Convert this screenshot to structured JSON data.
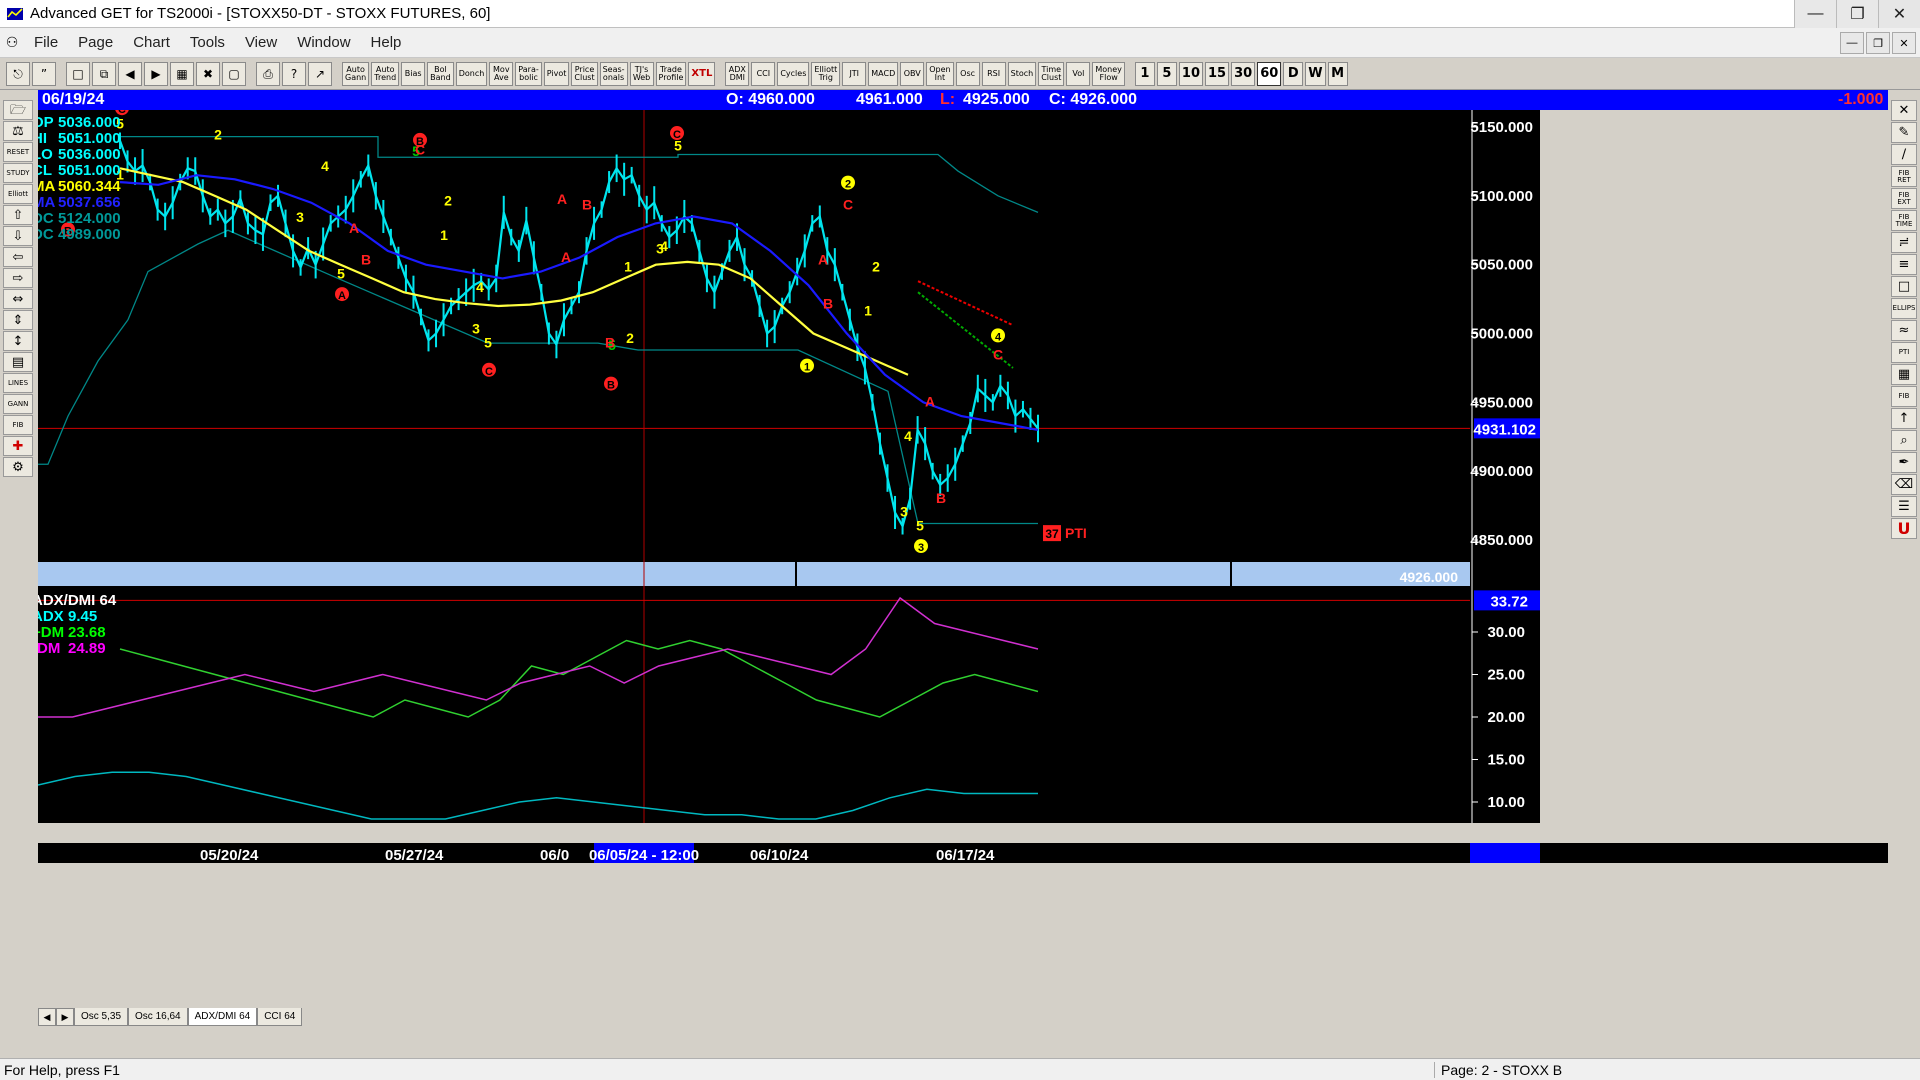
{
  "window": {
    "title": "Advanced GET for TS2000i - [STOXX50-DT - STOXX FUTURES, 60]"
  },
  "menu": [
    "File",
    "Page",
    "Chart",
    "Tools",
    "View",
    "Window",
    "Help"
  ],
  "toolbar": {
    "study_buttons": [
      "Auto\nGann",
      "Auto\nTrend",
      "Bias",
      "Bol\nBand",
      "Donch",
      "Mov\nAve",
      "Para-\nbolic",
      "Pivot",
      "Price\nClust",
      "Seas-\nonals",
      "TJ's\nWeb",
      "Trade\nProfile",
      "XTL"
    ],
    "study_buttons_2": [
      "ADX\nDMI",
      "CCI",
      "Cycles",
      "Elliott\nTrig",
      "JTI",
      "MACD",
      "OBV",
      "Open\nInt",
      "Osc",
      "RSI",
      "Stoch",
      "Time\nClust",
      "Vol",
      "Money\nFlow"
    ],
    "intervals": [
      "1",
      "5",
      "10",
      "15",
      "30",
      "60",
      "D",
      "W",
      "M"
    ],
    "active_interval": "60"
  },
  "left_tools": [
    "RESET",
    "STUDY",
    "Elliott",
    "LINES",
    "GANN",
    "FIB"
  ],
  "right_tools": [
    "FIB RET",
    "FIB EXT",
    "FIB TIME",
    "ELLIPS",
    "PTI",
    "FIB"
  ],
  "info_bar": {
    "date": "06/19/24",
    "open": "O: 4960.000",
    "high": "4961.000",
    "low_label": "L:",
    "low": "4925.000",
    "close": "C: 4926.000",
    "change": "-1.000"
  },
  "price_panel": {
    "stats": [
      {
        "label": "OP",
        "value": "5036.000",
        "color": "#00ffff"
      },
      {
        "label": "HI",
        "value": "5051.000",
        "color": "#00ffff"
      },
      {
        "label": "LO",
        "value": "5036.000",
        "color": "#00ffff"
      },
      {
        "label": "CL",
        "value": "5051.000",
        "color": "#00ffff"
      },
      {
        "label": "MA",
        "value": "5060.344",
        "color": "#ffff00"
      },
      {
        "label": "MA",
        "value": "5037.656",
        "color": "#2222ff"
      },
      {
        "label": "DC",
        "value": "5124.000",
        "color": "#009999"
      },
      {
        "label": "DC",
        "value": "4989.000",
        "color": "#009999"
      }
    ],
    "y_ticks": [
      "5150.000",
      "5100.000",
      "5050.000",
      "5000.000",
      "4950.000",
      "4900.000",
      "4850.000"
    ],
    "y_tick_values": [
      5150,
      5100,
      5050,
      5000,
      4950,
      4900,
      4850
    ],
    "last_price": "4931.102",
    "last_price_value": 4931.102,
    "band_label": "4926.000",
    "pti_value": "37",
    "pti_label": "PTI"
  },
  "adx_panel": {
    "title": "ADX/DMI 64",
    "stats": [
      {
        "label": "ADX",
        "value": "9.45",
        "color": "#00ffff"
      },
      {
        "label": "+DM",
        "value": "23.68",
        "color": "#00ff00"
      },
      {
        "label": "-DM",
        "value": "24.89",
        "color": "#ff00ff"
      }
    ],
    "y_ticks": [
      "30.00",
      "25.00",
      "20.00",
      "15.00",
      "10.00"
    ],
    "y_tick_values": [
      30,
      25,
      20,
      15,
      10
    ],
    "level_label": "33.72",
    "level_value": 33.72
  },
  "x_axis": {
    "ticks": [
      "05/20/24",
      "05/27/24",
      "06/0",
      "06/10/24",
      "06/17/24"
    ],
    "cursor_label": "06/05/24 - 12:00"
  },
  "sheet_tabs": [
    "Osc 5,35",
    "Osc 16,64",
    "ADX/DMI 64",
    "CCI 64"
  ],
  "active_tab": "ADX/DMI 64",
  "status": {
    "help": "For Help, press F1",
    "page": "Page: 2 - STOXX B"
  },
  "chart_data": {
    "type": "line",
    "instrument": "STOXX50-DT - STOXX FUTURES, 60",
    "price_series": [
      5140,
      5125,
      5118,
      5122,
      5110,
      5090,
      5085,
      5095,
      5110,
      5120,
      5118,
      5100,
      5085,
      5090,
      5080,
      5085,
      5098,
      5080,
      5075,
      5072,
      5095,
      5100,
      5080,
      5060,
      5048,
      5062,
      5050,
      5065,
      5080,
      5085,
      5090,
      5100,
      5112,
      5122,
      5100,
      5085,
      5070,
      5055,
      5040,
      5030,
      5012,
      4995,
      5000,
      5010,
      5020,
      5025,
      5030,
      5035,
      5038,
      5032,
      5040,
      5088,
      5070,
      5060,
      5082,
      5055,
      5030,
      5000,
      4992,
      5010,
      5020,
      5030,
      5060,
      5080,
      5090,
      5110,
      5120,
      5112,
      5115,
      5100,
      5090,
      5095,
      5080,
      5070,
      5075,
      5085,
      5080,
      5060,
      5040,
      5030,
      5045,
      5060,
      5070,
      5050,
      5040,
      5020,
      5000,
      5005,
      5020,
      5030,
      5045,
      5060,
      5080,
      5085,
      5060,
      5050,
      5030,
      5010,
      4990,
      4975,
      4950,
      4920,
      4895,
      4870,
      4860,
      4880,
      4930,
      4920,
      4900,
      4890,
      4895,
      4905,
      4920,
      4935,
      4960,
      4955,
      4950,
      4962,
      4955,
      4940,
      4945,
      4938,
      4931
    ],
    "ma_slow": [
      5120,
      5115,
      5110,
      5100,
      5090,
      5075,
      5060,
      5050,
      5040,
      5030,
      5025,
      5022,
      5020,
      5021,
      5024,
      5030,
      5040,
      5050,
      5052,
      5050,
      5040,
      5020,
      5000,
      4990,
      4980,
      4970
    ],
    "ma_fast": [
      5110,
      5108,
      5115,
      5112,
      5105,
      5095,
      5080,
      5060,
      5050,
      5045,
      5040,
      5045,
      5055,
      5070,
      5080,
      5085,
      5080,
      5060,
      5035,
      5000,
      4970,
      4950,
      4940,
      4935,
      4930
    ],
    "dmi_plus": [
      28,
      27,
      26,
      25,
      24,
      23,
      22,
      21,
      20,
      22,
      21,
      20,
      22,
      26,
      25,
      27,
      29,
      28,
      29,
      28,
      26,
      24,
      22,
      21,
      20,
      22,
      24,
      25,
      24,
      23
    ],
    "dmi_minus": [
      20,
      20,
      21,
      22,
      23,
      24,
      25,
      24,
      23,
      24,
      25,
      24,
      23,
      22,
      24,
      25,
      26,
      24,
      26,
      27,
      28,
      27,
      26,
      25,
      28,
      34,
      31,
      30,
      29,
      28
    ],
    "adx": [
      12,
      13,
      13.5,
      13.5,
      13,
      12,
      11,
      10,
      9,
      8,
      8,
      8,
      9,
      10,
      10.5,
      10,
      9.5,
      9,
      8.5,
      8.5,
      8,
      8,
      9,
      10.5,
      11.5,
      11,
      11,
      11
    ]
  }
}
